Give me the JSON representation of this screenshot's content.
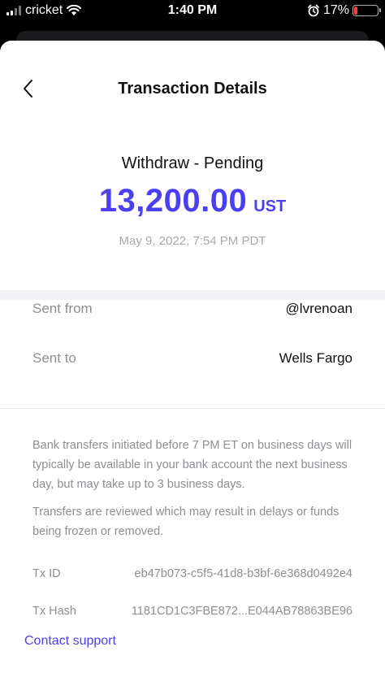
{
  "status_bar": {
    "carrier": "cricket",
    "time": "1:40 PM",
    "battery_percent": "17%",
    "battery_level": 0.17,
    "signal_icon": "cellular-signal-icon",
    "wifi_icon": "wifi-icon",
    "alarm_icon": "alarm-clock-icon",
    "battery_color": "#ff3b30"
  },
  "header": {
    "title": "Transaction Details",
    "back_icon": "chevron-left-icon"
  },
  "summary": {
    "type_status": "Withdraw - Pending",
    "amount": "13,200.00",
    "currency": "UST",
    "date": "May 9, 2022, 7:54 PM PDT",
    "accent_color": "#4b3ff0"
  },
  "details": {
    "sent_from_label": "Sent from",
    "sent_from_value": "@lvrenoan",
    "sent_to_label": "Sent to",
    "sent_to_value": "Wells Fargo"
  },
  "notes": {
    "bank_transfer_note": "Bank transfers initiated before 7 PM ET on business days will typically be available in your bank account the next business day, but may take up to 3 business days.",
    "review_note": "Transfers are reviewed which may result in delays or funds being frozen or removed."
  },
  "meta": {
    "tx_id_label": "Tx ID",
    "tx_id_value": "eb47b073-c5f5-41d8-b3bf-6e368d0492e4",
    "tx_hash_label": "Tx Hash",
    "tx_hash_value": "1181CD1C3FBE872...E044AB78863BE96"
  },
  "footer": {
    "contact_support": "Contact support"
  }
}
